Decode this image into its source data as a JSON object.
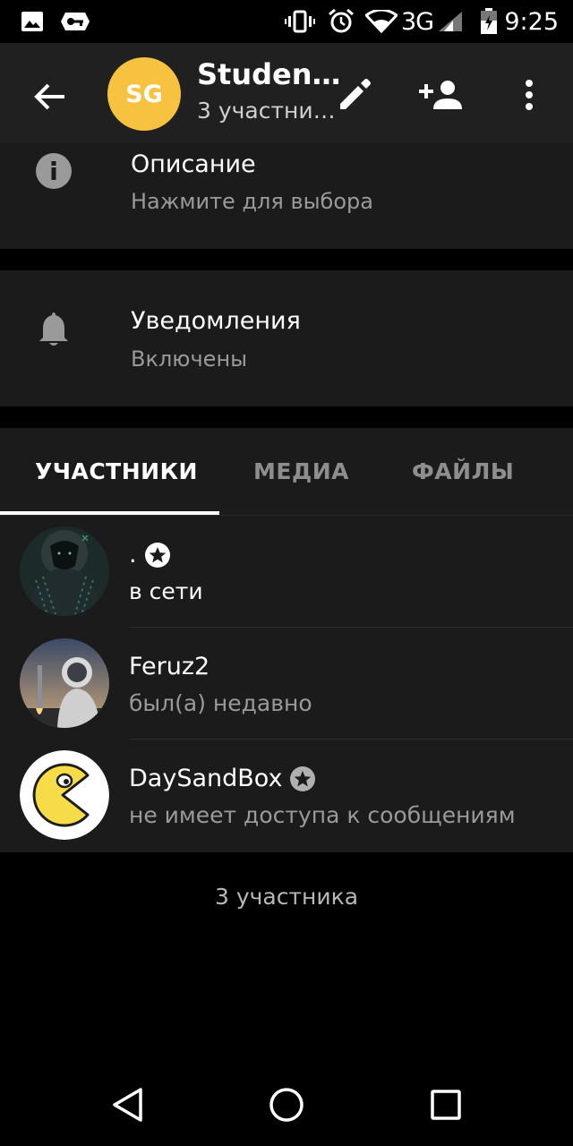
{
  "status_bar": {
    "time": "9:25",
    "network": "3G",
    "icons": [
      "image-icon",
      "vpn-key-icon",
      "vibrate-icon",
      "alarm-icon",
      "wifi-icon",
      "signal-icon",
      "battery-icon"
    ]
  },
  "toolbar": {
    "avatar_initials": "SG",
    "avatar_color": "#f6c23f",
    "title": "Studen…",
    "subtitle": "3 участни…"
  },
  "info": {
    "description_label": "Описание",
    "description_hint": "Нажмите для выбора",
    "notifications_label": "Уведомления",
    "notifications_value": "Включены"
  },
  "tabs": [
    {
      "label": "УЧАСТНИКИ",
      "active": true
    },
    {
      "label": "МЕДИА",
      "active": false
    },
    {
      "label": "ФАЙЛЫ",
      "active": false
    }
  ],
  "members": [
    {
      "name": ".",
      "status": "в сети",
      "status_color": "#ffffff",
      "admin": true
    },
    {
      "name": "Feruz2",
      "status": "был(а) недавно",
      "status_color": "#9a9a9a",
      "admin": false
    },
    {
      "name": "DaySandBox",
      "status": "не имеет доступа к сообщениям",
      "status_color": "#9a9a9a",
      "admin": true
    }
  ],
  "members_count": "3 участника",
  "colors": {
    "toolbar_bg": "#202020",
    "section_bg": "#1b1b1b",
    "background": "#000000"
  }
}
